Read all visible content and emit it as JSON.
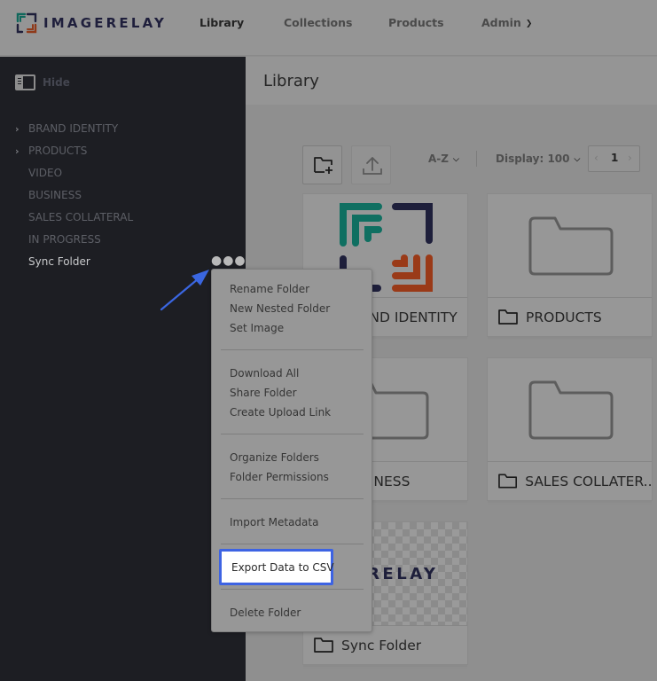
{
  "app": {
    "logo_text": "IMAGERELAY"
  },
  "topnav": {
    "items": [
      {
        "label": "Library",
        "active": true
      },
      {
        "label": "Collections"
      },
      {
        "label": "Products"
      },
      {
        "label": "Admin",
        "has_dropdown": true
      }
    ]
  },
  "sidebar": {
    "hide_label": "Hide",
    "folders": [
      {
        "label": "BRAND IDENTITY",
        "expandable": true
      },
      {
        "label": "PRODUCTS",
        "expandable": true
      },
      {
        "label": "VIDEO"
      },
      {
        "label": "BUSINESS"
      },
      {
        "label": "SALES COLLATERAL"
      },
      {
        "label": "IN PROGRESS"
      },
      {
        "label": "Sync Folder",
        "active": true
      }
    ],
    "more_icon": "ellipsis-icon"
  },
  "main": {
    "title": "Library",
    "toolbar": {
      "new_folder_icon": "folder-plus-icon",
      "upload_icon": "upload-icon",
      "sort_label": "A-Z",
      "display_label": "Display: 100",
      "page": "1",
      "prev": "‹",
      "next": "›"
    },
    "cards": [
      {
        "label": "BRAND IDENTITY",
        "visible_label": "ND IDENTITY",
        "thumb": "logo"
      },
      {
        "label": "PRODUCTS",
        "thumb": "folder"
      },
      {
        "label": "BUSINESS",
        "visible_label": "NESS",
        "thumb": "folder"
      },
      {
        "label": "SALES COLLATER...",
        "thumb": "folder"
      },
      {
        "label": "Sync Folder",
        "thumb": "logo-text",
        "thumb_text": "GERELAY"
      }
    ]
  },
  "context_menu": {
    "groups": [
      [
        "Rename Folder",
        "New Nested Folder",
        "Set Image"
      ],
      [
        "Download All",
        "Share Folder",
        "Create Upload Link"
      ],
      [
        "Organize Folders",
        "Folder Permissions"
      ],
      [
        "Import Metadata"
      ],
      [
        "Export Data to CSV"
      ],
      [
        "Delete Folder"
      ]
    ],
    "highlighted": "Export Data to CSV"
  },
  "colors": {
    "highlight_border": "#3d63e3",
    "arrow": "#3a66e0",
    "logo_teal": "#0f7a6a",
    "logo_navy": "#1e1f3b",
    "logo_orange": "#a8401c"
  }
}
